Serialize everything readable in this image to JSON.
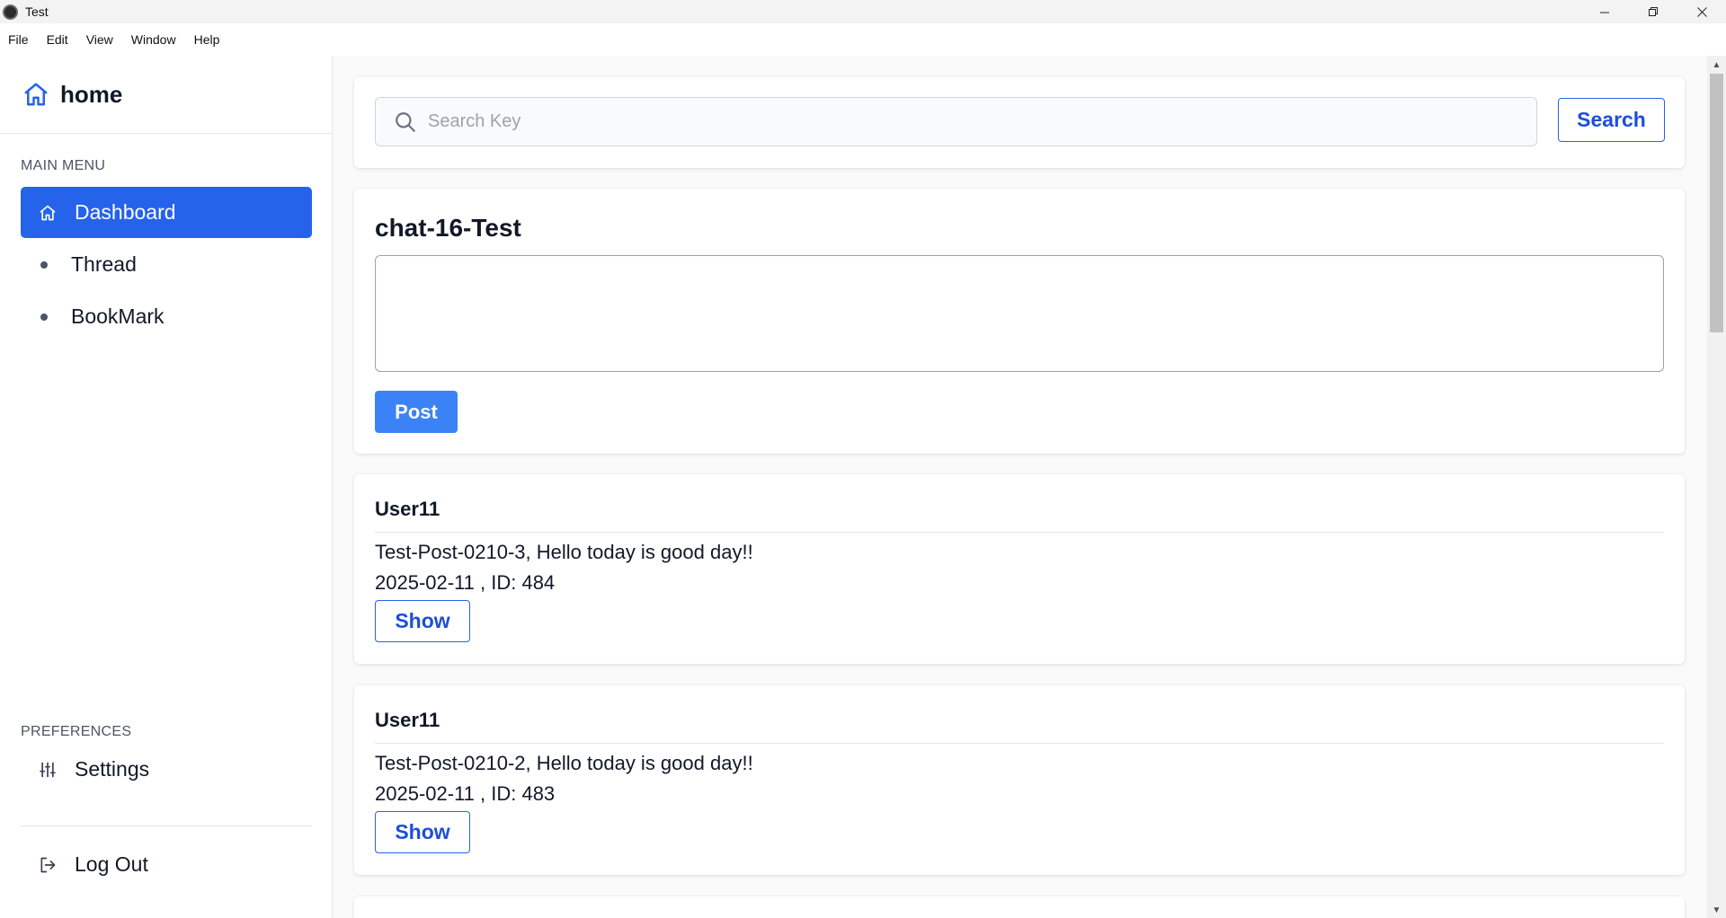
{
  "window": {
    "title": "Test",
    "controls": [
      "minimize",
      "maximize",
      "close"
    ]
  },
  "menubar": {
    "items": [
      "File",
      "Edit",
      "View",
      "Window",
      "Help"
    ]
  },
  "sidebar": {
    "brand": "home",
    "main_menu_label": "MAIN MENU",
    "items": [
      {
        "label": "Dashboard",
        "icon": "home-icon",
        "active": true
      },
      {
        "label": "Thread",
        "icon": "dot-icon"
      },
      {
        "label": "BookMark",
        "icon": "dot-icon"
      }
    ],
    "preferences_label": "PREFERENCES",
    "settings_label": "Settings",
    "logout_label": "Log Out"
  },
  "search": {
    "placeholder": "Search Key",
    "value": "",
    "button_label": "Search"
  },
  "composer": {
    "title": "chat-16-Test",
    "value": "",
    "post_label": "Post"
  },
  "posts": [
    {
      "author": "User11",
      "body": "Test-Post-0210-3, Hello today is good day!!",
      "meta": "2025-02-11 , ID: 484",
      "show_label": "Show"
    },
    {
      "author": "User11",
      "body": "Test-Post-0210-2, Hello today is good day!!",
      "meta": "2025-02-11 , ID: 483",
      "show_label": "Show"
    }
  ],
  "colors": {
    "accent": "#2563eb",
    "post_button": "#3b82f6"
  }
}
